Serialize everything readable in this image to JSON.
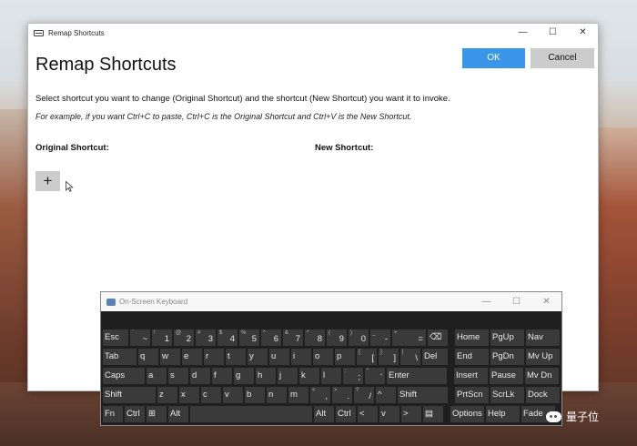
{
  "desktop": {},
  "remap_window": {
    "title": "Remap Shortcuts",
    "heading": "Remap Shortcuts",
    "ok_label": "OK",
    "cancel_label": "Cancel",
    "instruction": "Select shortcut you want to change (Original Shortcut) and the shortcut (New Shortcut) you want it to invoke.",
    "example": "For example, if you want Ctrl+C to paste, Ctrl+C is the Original Shortcut and Ctrl+V is the New Shortcut.",
    "original_header": "Original Shortcut:",
    "new_header": "New Shortcut:",
    "add_label": "+"
  },
  "window_controls": {
    "minimize": "—",
    "maximize": "☐",
    "close": "✕"
  },
  "osk": {
    "title": "On-Screen Keyboard",
    "controls": {
      "minimize": "—",
      "maximize": "☐",
      "close": "✕"
    },
    "row1": [
      "Esc",
      "~",
      "1",
      "2",
      "3",
      "4",
      "5",
      "6",
      "7",
      "8",
      "9",
      "0",
      "-",
      "=",
      "⌫",
      "Home",
      "PgUp",
      "Nav"
    ],
    "row1_sup": [
      "",
      "`",
      "!",
      "@",
      "#",
      "$",
      "%",
      "^",
      "&",
      "*",
      "(",
      ")",
      "_",
      "+",
      "",
      "",
      "",
      ""
    ],
    "row2": [
      "Tab",
      "q",
      "w",
      "e",
      "r",
      "t",
      "y",
      "u",
      "i",
      "o",
      "p",
      "[",
      "]",
      "\\",
      "Del",
      "End",
      "PgDn",
      "Mv Up"
    ],
    "row2_sup": [
      "",
      "",
      "",
      "",
      "",
      "",
      "",
      "",
      "",
      "",
      "",
      "{",
      "}",
      "|",
      "",
      "",
      "",
      ""
    ],
    "row3": [
      "Caps",
      "a",
      "s",
      "d",
      "f",
      "g",
      "h",
      "j",
      "k",
      "l",
      ";",
      "'",
      "Enter",
      "Insert",
      "Pause",
      "Mv Dn"
    ],
    "row3_sup": [
      "",
      "",
      "",
      "",
      "",
      "",
      "",
      "",
      "",
      "",
      ":",
      "\"",
      "",
      "",
      "",
      ""
    ],
    "row4": [
      "Shift",
      "z",
      "x",
      "c",
      "v",
      "b",
      "n",
      "m",
      ",",
      ".",
      "/",
      "^",
      "Shift",
      "PrtScn",
      "ScrLk",
      "Dock"
    ],
    "row4_sup": [
      "",
      "",
      "",
      "",
      "",
      "",
      "",
      "",
      "<",
      ">",
      "?",
      "",
      "",
      "",
      "",
      ""
    ],
    "row5": [
      "Fn",
      "Ctrl",
      "⊞",
      "Alt",
      "",
      "Alt",
      "Ctrl",
      "<",
      "v",
      ">",
      "▤",
      "Options",
      "Help",
      "Fade"
    ]
  },
  "watermark": {
    "text": "量子位"
  }
}
